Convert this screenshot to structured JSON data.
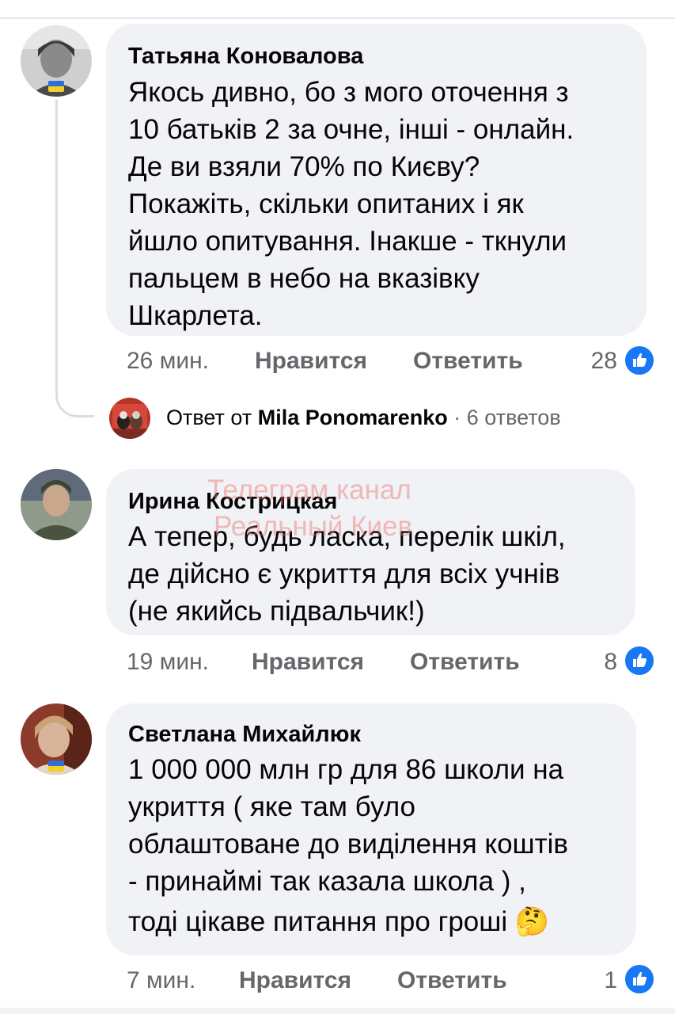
{
  "comments": [
    {
      "author": "Татьяна Коновалова",
      "lines": [
        "Якось дивно, бо з мого оточення з",
        "10 батьків 2 за очне, інші - онлайн.",
        "Де ви взяли 70% по Києву?",
        "Покажіть, скільки опитаних і як",
        "йшло опитування. Інакше - ткнули",
        "пальцем в небо на вказівку",
        "Шкарлета."
      ],
      "time": "26 мин.",
      "like_label": "Нравится",
      "reply_label": "Ответить",
      "reactions": "28",
      "has_flag": true
    },
    {
      "author": "Ирина Кострицкая",
      "lines": [
        "А тепер, будь ласка, перелік шкіл,",
        "де дійсно є укриття для всіх учнів",
        "(не якийсь підвальчик!)"
      ],
      "time": "19 мин.",
      "like_label": "Нравится",
      "reply_label": "Ответить",
      "reactions": "8",
      "has_flag": false
    },
    {
      "author": "Светлана Михайлюк",
      "lines": [
        "1 000 000 млн гр для 86 школи на",
        "укриття ( яке там було",
        "облаштоване до виділення коштів",
        "- принаймі так казала школа ) ,",
        "тоді цікаве питання про гроші"
      ],
      "emoji": "🤔",
      "time": "7 мин.",
      "like_label": "Нравится",
      "reply_label": "Ответить",
      "reactions": "1",
      "has_flag": true
    }
  ],
  "replies": {
    "prefix": "Ответ от",
    "name": "Mila Ponomarenko",
    "separator": "·",
    "count": "6 ответов"
  },
  "watermark": {
    "line1": "Телеграм канал",
    "line2": "Реальный Киев"
  },
  "colors": {
    "bubble": "#f0f2f5",
    "secondary_text": "#65676b",
    "like_blue": "#1877f2",
    "flag_blue": "#2f6fd6",
    "flag_yellow": "#f6cf27"
  },
  "icons": {
    "like": "thumbs-up-icon",
    "flag": "ukraine-flag-icon"
  }
}
